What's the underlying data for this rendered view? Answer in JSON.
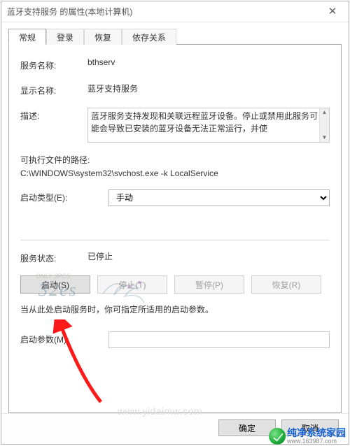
{
  "window": {
    "title": "蓝牙支持服务 的属性(本地计算机)"
  },
  "tabs": [
    {
      "label": "常规",
      "active": true
    },
    {
      "label": "登录",
      "active": false
    },
    {
      "label": "恢复",
      "active": false
    },
    {
      "label": "依存关系",
      "active": false
    }
  ],
  "general": {
    "service_name_label": "服务名称:",
    "service_name": "bthserv",
    "display_name_label": "显示名称:",
    "display_name": "蓝牙支持服务",
    "description_label": "描述:",
    "description": "蓝牙服务支持发现和关联远程蓝牙设备。停止或禁用此服务可能会导致已安装的蓝牙设备无法正常运行，并使",
    "exe_path_label": "可执行文件的路径:",
    "exe_path": "C:\\WINDOWS\\system32\\svchost.exe -k LocalService",
    "startup_type_label": "启动类型(E):",
    "startup_type_value": "手动",
    "status_label": "服务状态:",
    "status_value": "已停止",
    "buttons": {
      "start": "启动(S)",
      "stop": "停止(T)",
      "pause": "暂停(P)",
      "resume": "恢复(R)"
    },
    "hint": "当从此处启动服务时，你可指定所适用的启动参数。",
    "param_label": "启动参数(M):",
    "param_value": ""
  },
  "dialog": {
    "ok": "确定",
    "cancel": "取消"
  },
  "watermark": {
    "site_name": "纯净系统家园",
    "site_sub": "www.163987.com"
  },
  "overlay_url": "www.yidaimw.com",
  "deco_small": "ONLY 3PCS"
}
